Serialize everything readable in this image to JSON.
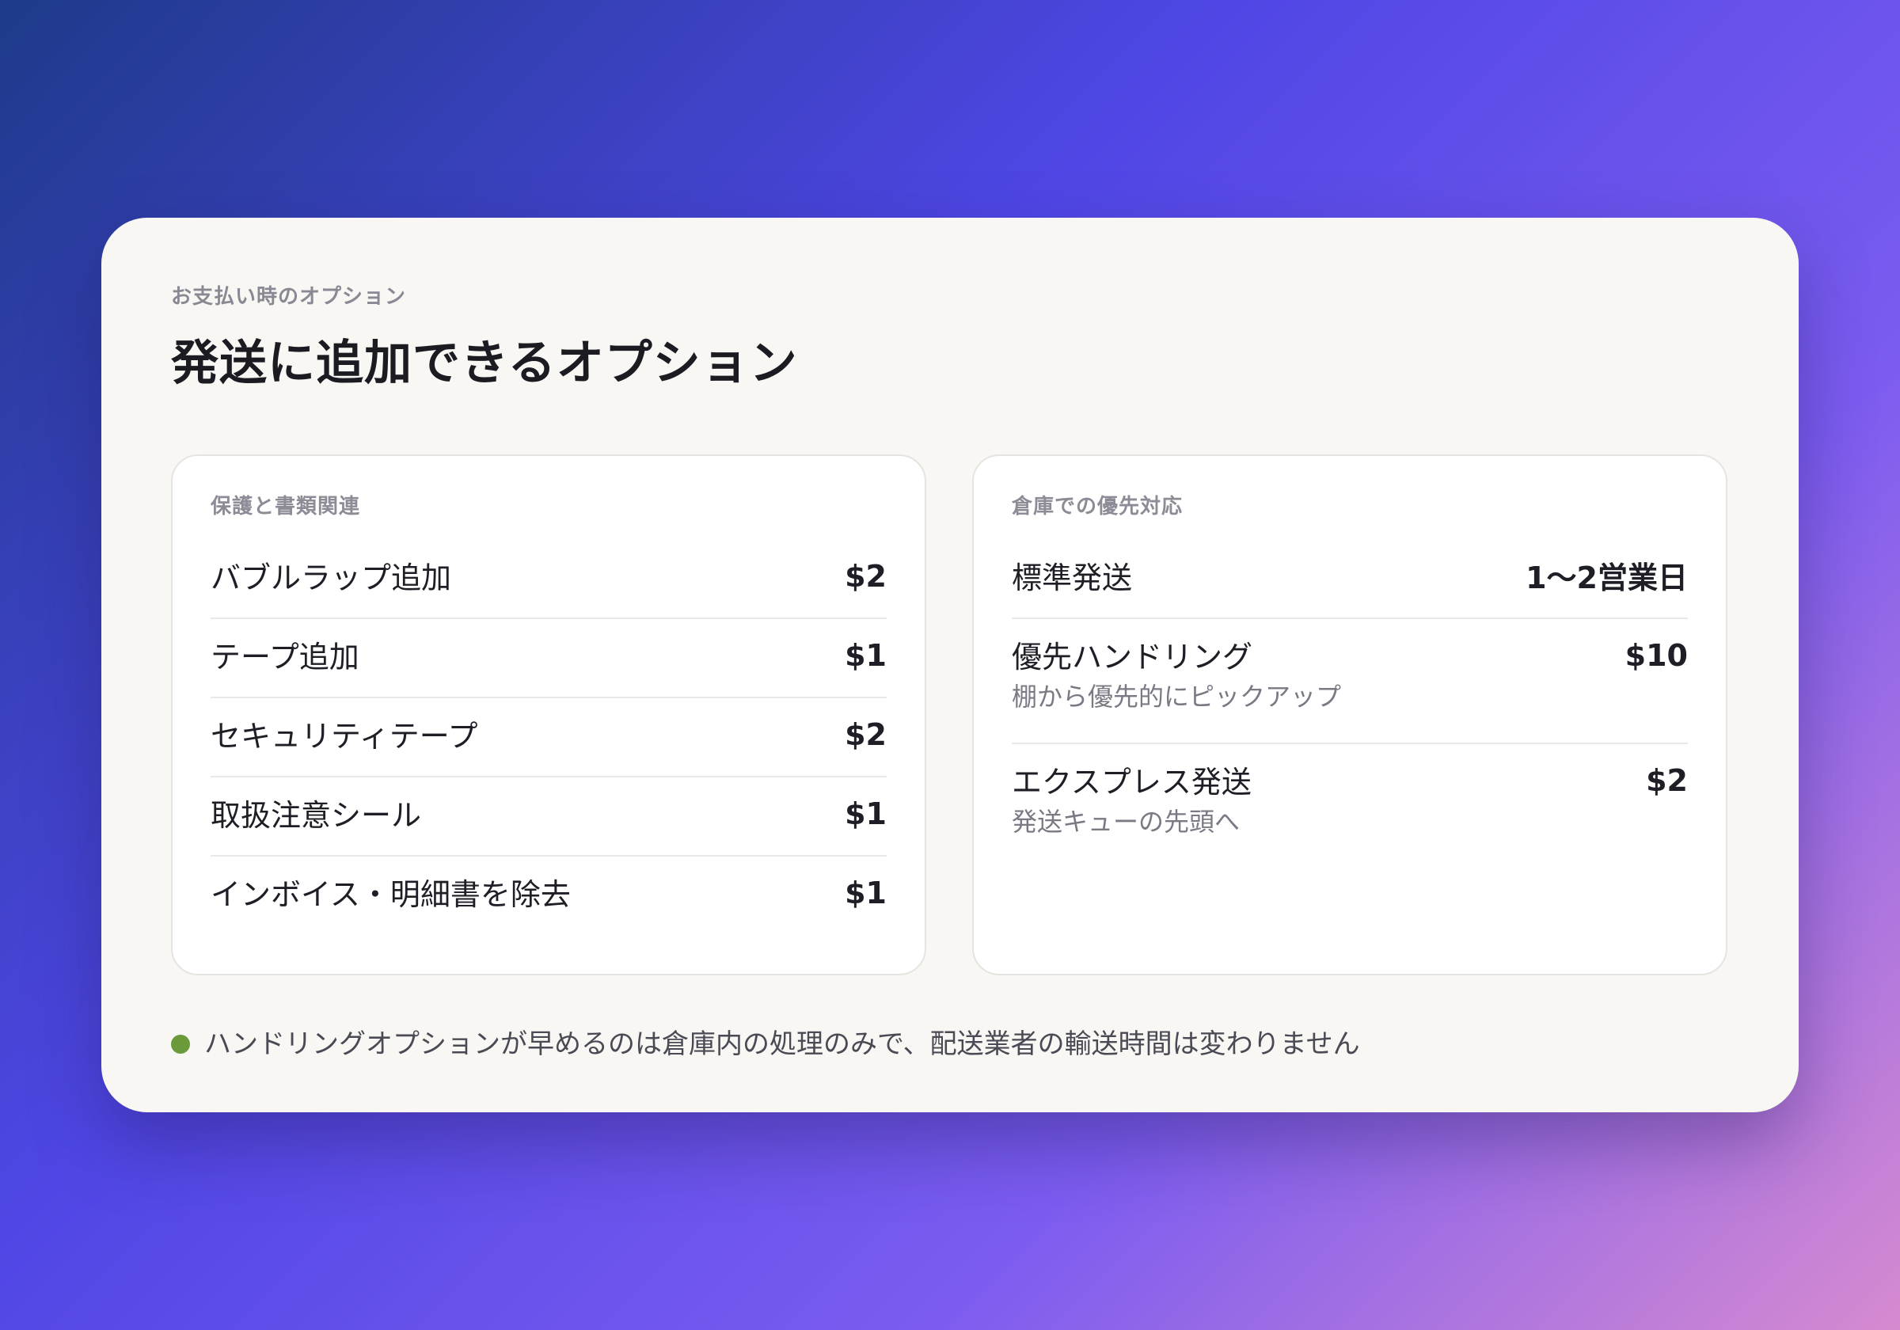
{
  "header": {
    "eyebrow": "お支払い時のオプション",
    "title": "発送に追加できるオプション"
  },
  "protection_panel": {
    "title": "保護と書類関連",
    "items": [
      {
        "name": "バブルラップ追加",
        "price": "$2"
      },
      {
        "name": "テープ追加",
        "price": "$1"
      },
      {
        "name": "セキュリティテープ",
        "price": "$2"
      },
      {
        "name": "取扱注意シール",
        "price": "$1"
      },
      {
        "name": "インボイス・明細書を除去",
        "price": "$1"
      }
    ]
  },
  "priority_panel": {
    "title": "倉庫での優先対応",
    "items": [
      {
        "name": "標準発送",
        "price": "1〜2営業日",
        "sub": ""
      },
      {
        "name": "優先ハンドリング",
        "price": "$10",
        "sub": "棚から優先的にピックアップ"
      },
      {
        "name": "エクスプレス発送",
        "price": "$2",
        "sub": "発送キューの先頭へ"
      }
    ]
  },
  "footer": {
    "note": "ハンドリングオプションが早めるのは倉庫内の処理のみで、配送業者の輸送時間は変わりません",
    "dot_color": "#6a9a3a"
  }
}
